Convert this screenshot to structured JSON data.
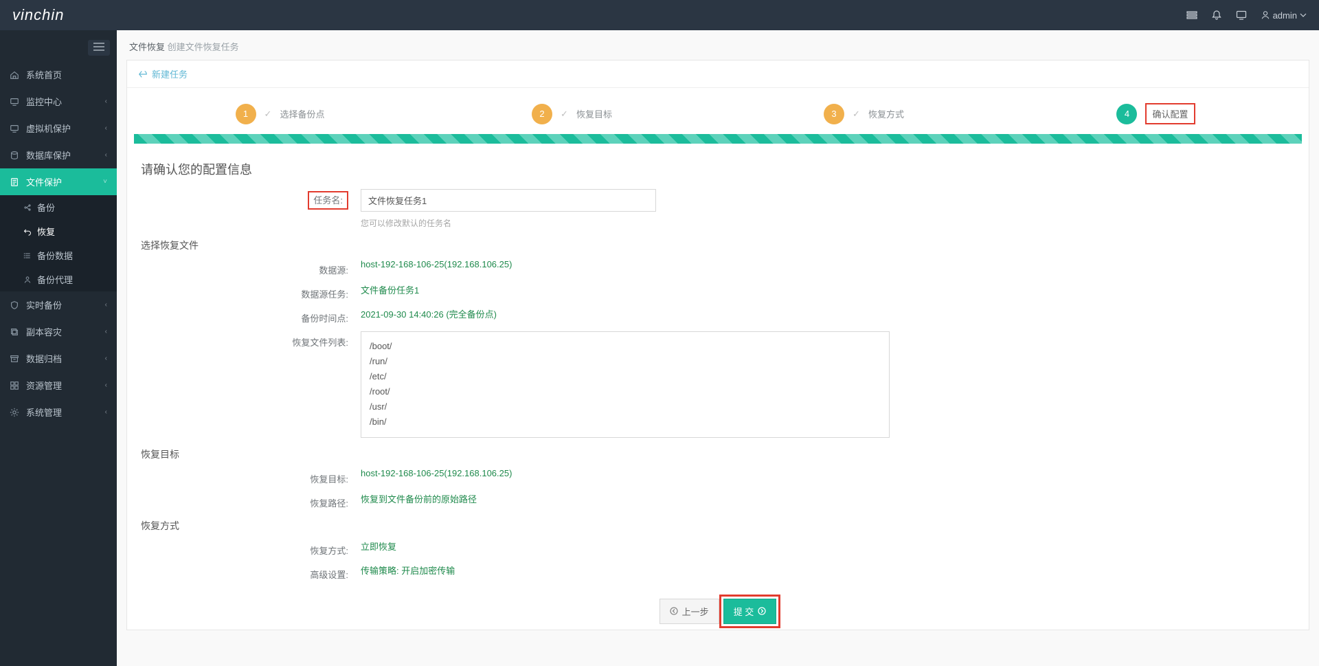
{
  "header": {
    "logo": "vinchin",
    "user": "admin"
  },
  "sidebar": {
    "items": [
      {
        "icon": "home",
        "label": "系统首页"
      },
      {
        "icon": "monitor",
        "label": "监控中心",
        "chev": true
      },
      {
        "icon": "monitor",
        "label": "虚拟机保护",
        "chev": true
      },
      {
        "icon": "db",
        "label": "数据库保护",
        "chev": true
      },
      {
        "icon": "doc",
        "label": "文件保护",
        "chev": true,
        "active": true
      },
      {
        "icon": "shield",
        "label": "实时备份",
        "chev": true
      },
      {
        "icon": "copy",
        "label": "副本容灾",
        "chev": true
      },
      {
        "icon": "archive",
        "label": "数据归档",
        "chev": true
      },
      {
        "icon": "res",
        "label": "资源管理",
        "chev": true
      },
      {
        "icon": "gear",
        "label": "系统管理",
        "chev": true
      }
    ],
    "sub": [
      {
        "icon": "share",
        "label": "备份"
      },
      {
        "icon": "undo",
        "label": "恢复",
        "active": true
      },
      {
        "icon": "list",
        "label": "备份数据"
      },
      {
        "icon": "agent",
        "label": "备份代理"
      }
    ]
  },
  "breadcrumb": {
    "main": "文件恢复",
    "sub": "创建文件恢复任务"
  },
  "back": "新建任务",
  "wizard": [
    {
      "n": "1",
      "label": "选择备份点"
    },
    {
      "n": "2",
      "label": "恢复目标"
    },
    {
      "n": "3",
      "label": "恢复方式"
    },
    {
      "n": "4",
      "label": "确认配置",
      "cur": true
    }
  ],
  "confirm_title": "请确认您的配置信息",
  "task": {
    "label": "任务名:",
    "value": "文件恢复任务1",
    "hint": "您可以修改默认的任务名"
  },
  "src_title": "选择恢复文件",
  "src": {
    "data_label": "数据源:",
    "data_val": "host-192-168-106-25(192.168.106.25)",
    "task_label": "数据源任务:",
    "task_val": "文件备份任务1",
    "time_label": "备份时间点:",
    "time_val": "2021-09-30 14:40:26 (完全备份点)",
    "files_label": "恢复文件列表:",
    "files": [
      "/boot/",
      "/run/",
      "/etc/",
      "/root/",
      "/usr/",
      "/bin/"
    ]
  },
  "tgt_title": "恢复目标",
  "tgt": {
    "target_label": "恢复目标:",
    "target_val": "host-192-168-106-25(192.168.106.25)",
    "path_label": "恢复路径:",
    "path_val": "恢复到文件备份前的原始路径"
  },
  "mode_title": "恢复方式",
  "mode": {
    "mode_label": "恢复方式:",
    "mode_val": "立即恢复",
    "adv_label": "高级设置:",
    "adv_val": "传输策略: 开启加密传输"
  },
  "buttons": {
    "prev": "上一步",
    "submit": "提 交"
  }
}
